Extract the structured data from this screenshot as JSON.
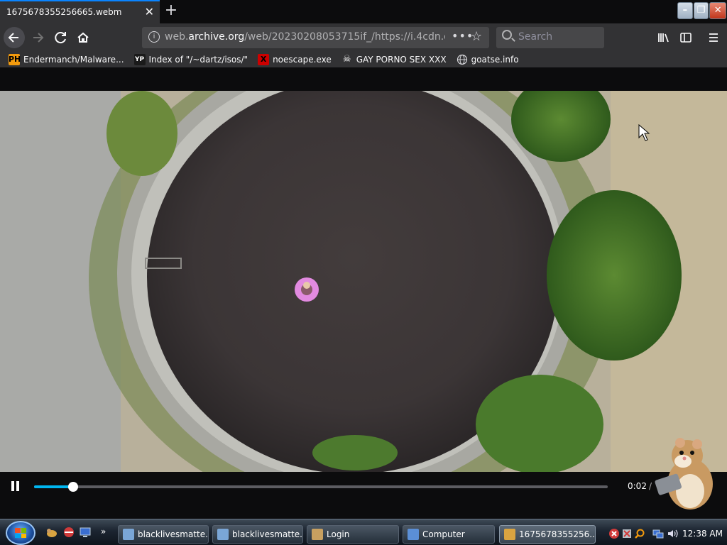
{
  "browser": {
    "tab_title": "1675678355256665.webm",
    "tab_close": "✕",
    "new_tab": "+",
    "url_host_prefix": "web.",
    "url_host": "archive.org",
    "url_path": "/web/20230208053715if_/https://i.4cdn.org/",
    "url_info_icon": "i",
    "search_placeholder": "Search",
    "window_buttons": [
      "–",
      "❐",
      "✕"
    ]
  },
  "bookmarks": [
    {
      "label": "Endermanch/Malware...",
      "icon": "PH",
      "icon_bg": "#f29a0d",
      "icon_fg": "#000000"
    },
    {
      "label": "Index of \"/~dartz/isos/\"",
      "icon": "YP",
      "icon_bg": "#1a1a1a",
      "icon_fg": "#ffffff"
    },
    {
      "label": "noescape.exe",
      "icon": "X",
      "icon_bg": "#cc0000",
      "icon_fg": "#000000"
    },
    {
      "label": "GAY PORNO SEX XXX",
      "icon": "☠",
      "icon_bg": "#323234",
      "icon_fg": "#ffffff"
    },
    {
      "label": "goatse.info",
      "icon": "🌐",
      "icon_bg": "#323234",
      "icon_fg": "#d7d7db"
    }
  ],
  "video": {
    "current_time": "0:02",
    "time_separator": "/",
    "progress": 0.068
  },
  "taskbar": {
    "buttons": [
      {
        "label": "blacklivesmatte...",
        "icon_color": "#7aa6d6"
      },
      {
        "label": "blacklivesmatte...",
        "icon_color": "#7aa6d6"
      },
      {
        "label": "Login",
        "icon_color": "#c8a060"
      },
      {
        "label": "Computer",
        "icon_color": "#5b8fd6"
      },
      {
        "label": "1675678355256...",
        "icon_color": "#d9a441",
        "active": true
      }
    ],
    "clock": "12:38 AM",
    "overflow_chevron": "»"
  },
  "colors": {
    "accent": "#0a84ff",
    "progress": "#00b6f0",
    "toolbar": "#323234"
  }
}
